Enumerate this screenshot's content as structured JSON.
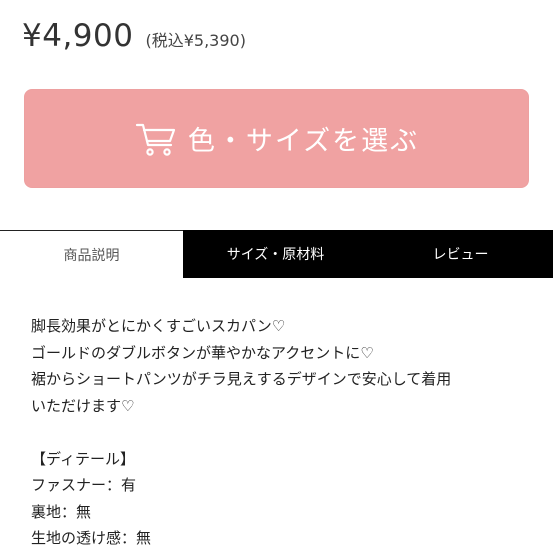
{
  "price": {
    "main": "¥4,900",
    "tax_included": "(税込¥5,390)"
  },
  "select_button": {
    "label": "色・サイズを選ぶ",
    "icon": "shopping-cart-icon",
    "color": "#f0a2a2"
  },
  "tabs": [
    {
      "label": "商品説明",
      "active": true
    },
    {
      "label": "サイズ・原材料",
      "active": false
    },
    {
      "label": "レビュー",
      "active": false
    }
  ],
  "description": {
    "lines": [
      "脚長効果がとにかくすごいスカパン♡",
      "ゴールドのダブルボタンが華やかなアクセントに♡",
      "裾からショートパンツがチラ見えするデザインで安心して着用",
      "いただけます♡"
    ],
    "details_heading": "【ディテール】",
    "details": [
      "ファスナー：有",
      "裏地：無",
      "生地の透け感：無"
    ]
  }
}
